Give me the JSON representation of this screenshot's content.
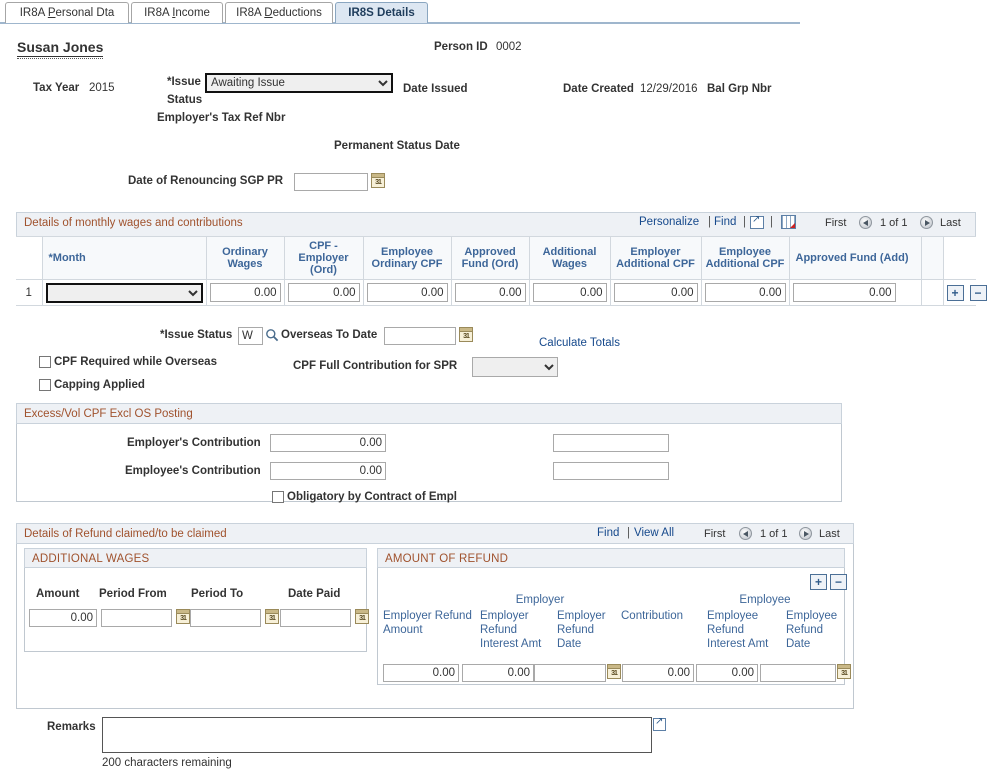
{
  "tabs": [
    {
      "label": "IR8A Personal Dta",
      "accel": "P",
      "active": false
    },
    {
      "label": "IR8A Income",
      "accel": "I",
      "active": false
    },
    {
      "label": "IR8A Deductions",
      "accel": "D",
      "active": false
    },
    {
      "label": "IR8S Details",
      "accel": "",
      "active": true
    }
  ],
  "header": {
    "person_name": "Susan Jones",
    "person_id_label": "Person ID",
    "person_id_value": "0002",
    "tax_year_label": "Tax Year",
    "tax_year_value": "2015",
    "issue_status_label": "*Issue Status",
    "issue_status_value": "Awaiting Issue",
    "issue_status_options": [
      "Awaiting Issue"
    ],
    "date_issued_label": "Date Issued",
    "date_created_label": "Date Created",
    "date_created_value": "12/29/2016",
    "bal_grp_nbr_label": "Bal Grp Nbr",
    "employers_tax_ref_label": "Employer's Tax Ref Nbr",
    "permanent_status_date_label": "Permanent Status Date",
    "date_renouncing_label": "Date of Renouncing SGP PR",
    "date_renouncing_value": ""
  },
  "monthly_grid": {
    "title": "Details of monthly wages and contributions",
    "personalize_label": "Personalize",
    "find_label": "Find",
    "expand_icon": "expand-icon",
    "download_icon": "grid-download-icon",
    "first_label": "First",
    "page_indicator": "1 of 1",
    "last_label": "Last",
    "columns": [
      "*Month",
      "Ordinary Wages",
      "CPF - Employer (Ord)",
      "Employee Ordinary CPF",
      "Approved Fund (Ord)",
      "Additional Wages",
      "Employer Additional CPF",
      "Employee Additional CPF",
      "Approved Fund (Add)"
    ],
    "rows": [
      {
        "num": "1",
        "month": "",
        "month_options": [
          ""
        ],
        "ordinary_wages": "0.00",
        "cpf_employer_ord": "0.00",
        "employee_ordinary_cpf": "0.00",
        "approved_fund_ord": "0.00",
        "additional_wages": "0.00",
        "employer_additional_cpf": "0.00",
        "employee_additional_cpf": "0.00",
        "approved_fund_add": "0.00"
      }
    ],
    "add_row_label": "+",
    "delete_row_label": "−"
  },
  "issue_row": {
    "issue_status_label": "*Issue Status",
    "issue_status_value": "W",
    "lookup_icon": "magnifier-icon",
    "overseas_to_date_label": "Overseas To Date",
    "overseas_to_date_value": "",
    "calculate_totals_label": "Calculate Totals",
    "cpf_required_overseas_label": "CPF Required while Overseas",
    "cpf_required_overseas_checked": false,
    "capping_applied_label": "Capping Applied",
    "capping_applied_checked": false,
    "cpf_full_contribution_label": "CPF Full Contribution for SPR",
    "cpf_full_contribution_value": "",
    "cpf_full_contribution_options": [
      ""
    ]
  },
  "excess_section": {
    "caption": "Excess/Vol CPF Excl OS Posting",
    "employer_contribution_label": "Employer's Contribution",
    "employer_contribution_value": "0.00",
    "employer_contribution_extra": "",
    "employee_contribution_label": "Employee's Contribution",
    "employee_contribution_value": "0.00",
    "employee_contribution_extra": "",
    "obligatory_label": "Obligatory by Contract of Empl",
    "obligatory_checked": false
  },
  "refund_section": {
    "title": "Details of Refund claimed/to be claimed",
    "find_label": "Find",
    "view_all_label": "View All",
    "first_label": "First",
    "page_indicator": "1 of 1",
    "last_label": "Last",
    "additional_wages": {
      "caption": "ADDITIONAL WAGES",
      "columns": [
        "Amount",
        "Period From",
        "Period To",
        "Date Paid"
      ],
      "row": {
        "amount": "0.00",
        "period_from": "",
        "period_to": "",
        "date_paid": ""
      }
    },
    "amount_of_refund": {
      "caption": "AMOUNT OF REFUND",
      "group_employer": "Employer",
      "group_employee": "Employee",
      "columns": [
        "Employer Refund Amount",
        "Employer Refund Interest Amt",
        "Employer Refund Date",
        "Contribution",
        "Employee Refund Interest Amt",
        "Employee Refund Date"
      ],
      "row": {
        "employer_refund_amount": "0.00",
        "employer_refund_interest_amt": "0.00",
        "employer_refund_date": "",
        "contribution": "0.00",
        "employee_refund_interest_amt": "0.00",
        "employee_refund_date": ""
      },
      "add_row_label": "+",
      "delete_row_label": "−"
    }
  },
  "remarks": {
    "label": "Remarks",
    "value": "",
    "counter": "200 characters remaining",
    "expand_icon": "expand-icon"
  },
  "colors": {
    "caption_text": "#a0522d",
    "link": "#16498c",
    "header_text": "#3d6699",
    "tab_active_bg": "#dde7f2"
  }
}
